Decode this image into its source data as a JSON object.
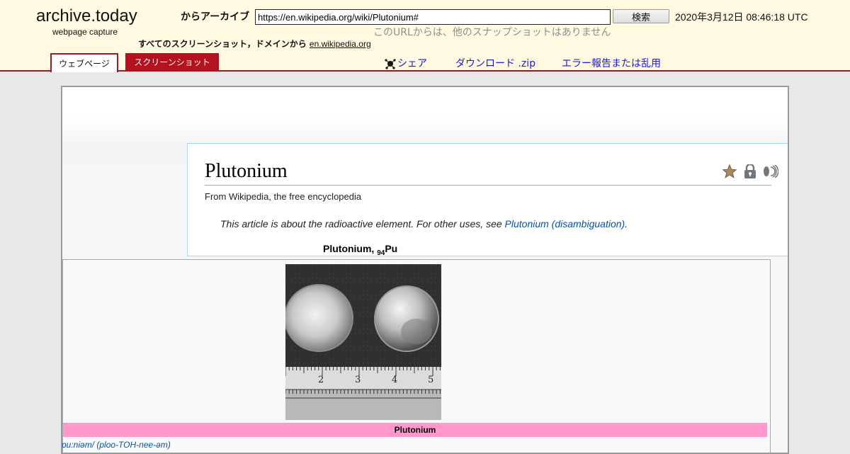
{
  "header": {
    "logo": "archive.today",
    "logo_sub": "webpage capture",
    "archive_label": "からアーカイブ",
    "url_value": "https://en.wikipedia.org/wiki/Plutonium#",
    "search_label": "検索",
    "timestamp": "2020年3月12日 08:46:18 UTC",
    "no_snapshots": "このURLからは、他のスナップショットはありません",
    "all_screenshots_label": "すべてのスクリーンショット，ドメインから",
    "domain_link": "en.wikipedia.org"
  },
  "tabs": {
    "webpage": "ウェブページ",
    "screenshot": "スクリーンショット"
  },
  "links": {
    "share": "シェア",
    "download": "ダウンロード .zip",
    "report": "エラー報告または乱用"
  },
  "article": {
    "title": "Plutonium",
    "tagline": "From Wikipedia, the free encyclopedia",
    "hatnote_prefix": "This article is about the radioactive element. For other uses, see ",
    "hatnote_link": "Plutonium (disambiguation)",
    "hatnote_suffix": "."
  },
  "infobox": {
    "caption_name": "Plutonium, ",
    "caption_sub": "94",
    "caption_symbol": "Pu",
    "name_row": "Plutonium",
    "pronunciation": "pu:niəm/ (ploo-TOH-nee-əm)"
  },
  "colors": {
    "header_bg": "#fff9e1",
    "accent_red": "#b4121f",
    "link_blue": "#1a1ad6",
    "wiki_link": "#0b4fa0",
    "infobox_name_bg": "#ff99cc"
  }
}
